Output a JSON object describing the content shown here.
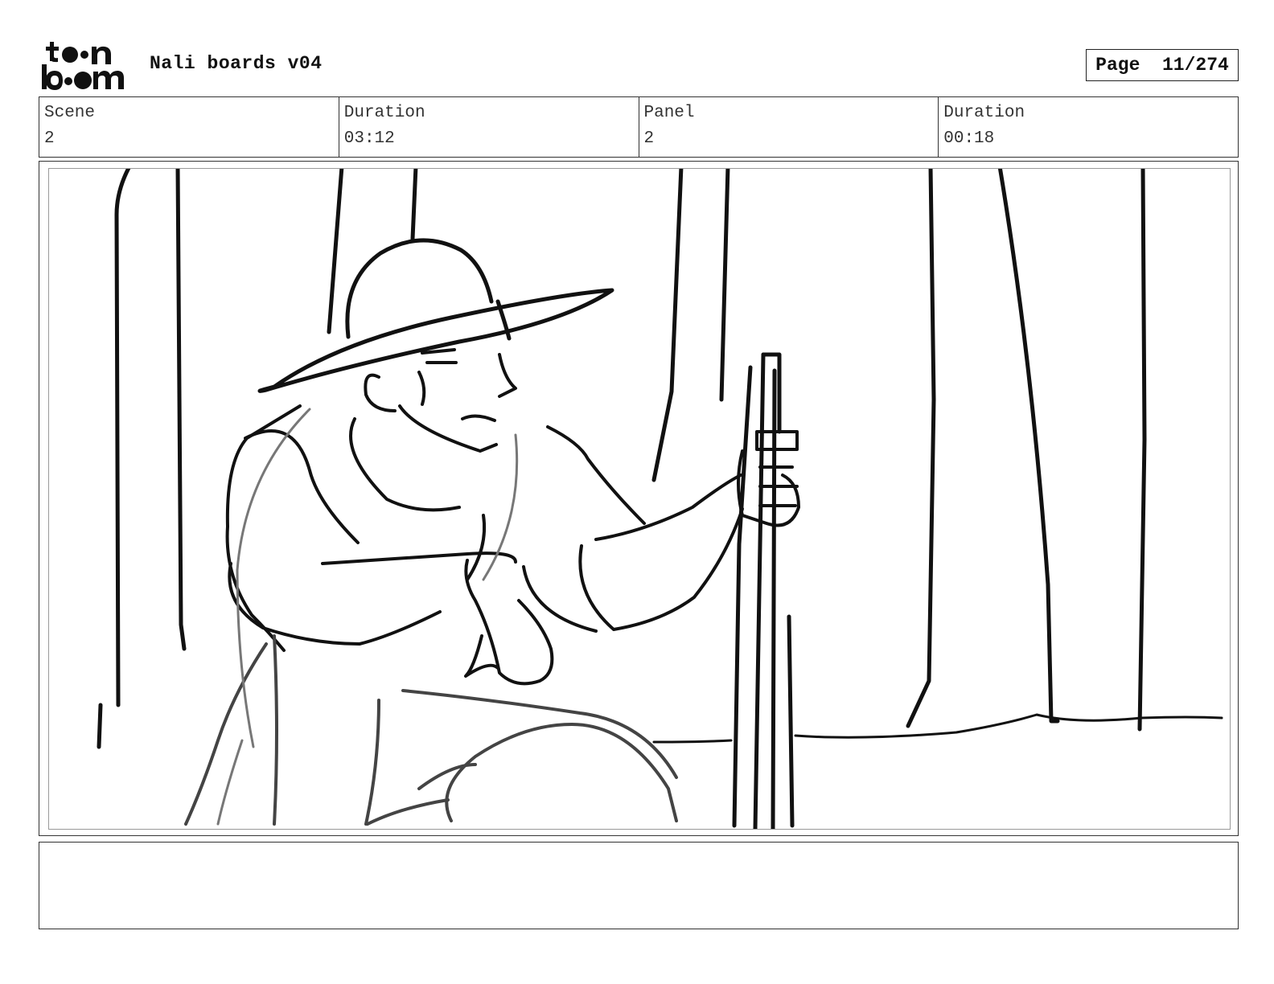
{
  "header": {
    "logo_text": "toon boom",
    "title": "Nali boards v04",
    "page_label": "Page",
    "page_number": "11/274"
  },
  "info": [
    {
      "label": "Scene",
      "value": "2"
    },
    {
      "label": "Duration",
      "value": "03:12"
    },
    {
      "label": "Panel",
      "value": "2"
    },
    {
      "label": "Duration",
      "value": "00:18"
    }
  ],
  "panel": {
    "image_icon": "storyboard-sketch"
  },
  "notes": {
    "text": ""
  }
}
